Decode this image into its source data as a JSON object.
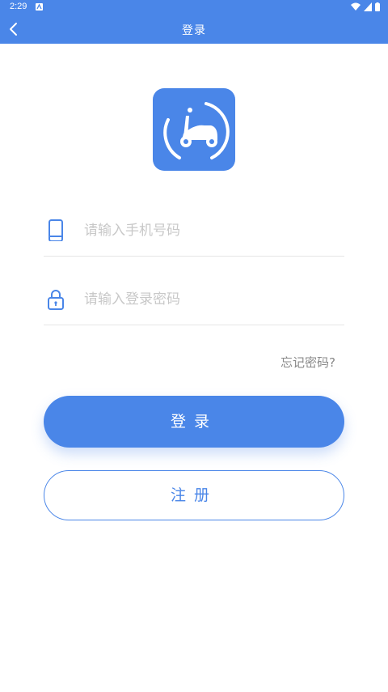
{
  "status_bar": {
    "time": "2:29"
  },
  "app_bar": {
    "title": "登录",
    "back_icon": "chevron-left-icon"
  },
  "logo": {
    "icon": "scooter-logo-icon",
    "bg_color": "#4a86e8"
  },
  "form": {
    "phone": {
      "placeholder": "请输入手机号码",
      "value": "",
      "icon": "phone-icon"
    },
    "password": {
      "placeholder": "请输入登录密码",
      "value": "",
      "icon": "lock-icon"
    },
    "forgot_label": "忘记密码?"
  },
  "buttons": {
    "login_label": "登录",
    "register_label": "注册"
  },
  "colors": {
    "accent": "#4a86e8",
    "placeholder": "#c8c8c8",
    "divider": "#e6e6e6"
  }
}
